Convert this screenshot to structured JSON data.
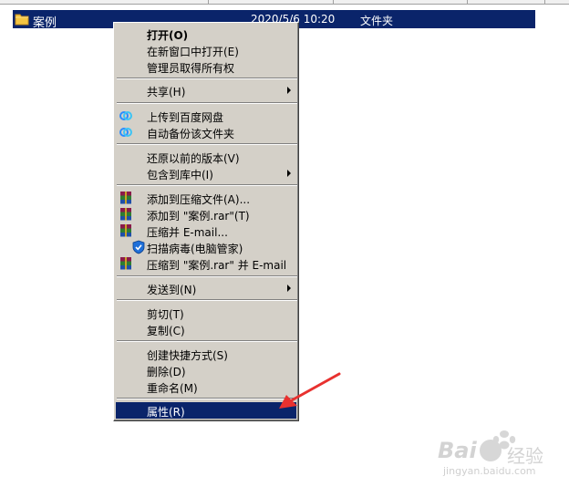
{
  "file_row": {
    "name": "案例",
    "date": "2020/5/6 10:20",
    "type": "文件夹"
  },
  "menu": {
    "open": "打开(O)",
    "open_new_window": "在新窗口中打开(E)",
    "take_ownership": "管理员取得所有权",
    "share": "共享(H)",
    "upload_baidu": "上传到百度网盘",
    "auto_backup": "自动备份该文件夹",
    "restore_previous": "还原以前的版本(V)",
    "include_in_library": "包含到库中(I)",
    "add_to_archive": "添加到压缩文件(A)...",
    "add_to_rar": "添加到 \"案例.rar\"(T)",
    "compress_email": "压缩并 E-mail...",
    "scan_virus": "扫描病毒(电脑管家)",
    "compress_rar_email": "压缩到 \"案例.rar\" 并 E-mail",
    "send_to": "发送到(N)",
    "cut": "剪切(T)",
    "copy": "复制(C)",
    "create_shortcut": "创建快捷方式(S)",
    "delete": "删除(D)",
    "rename": "重命名(M)",
    "properties": "属性(R)"
  },
  "watermark": {
    "brand": "Bai",
    "brand2": "经验",
    "url": "jingyan.baidu.com"
  },
  "colors": {
    "selection": "#0a246a",
    "menu_bg": "#d4d0c8",
    "annotation": "#e8312f"
  }
}
